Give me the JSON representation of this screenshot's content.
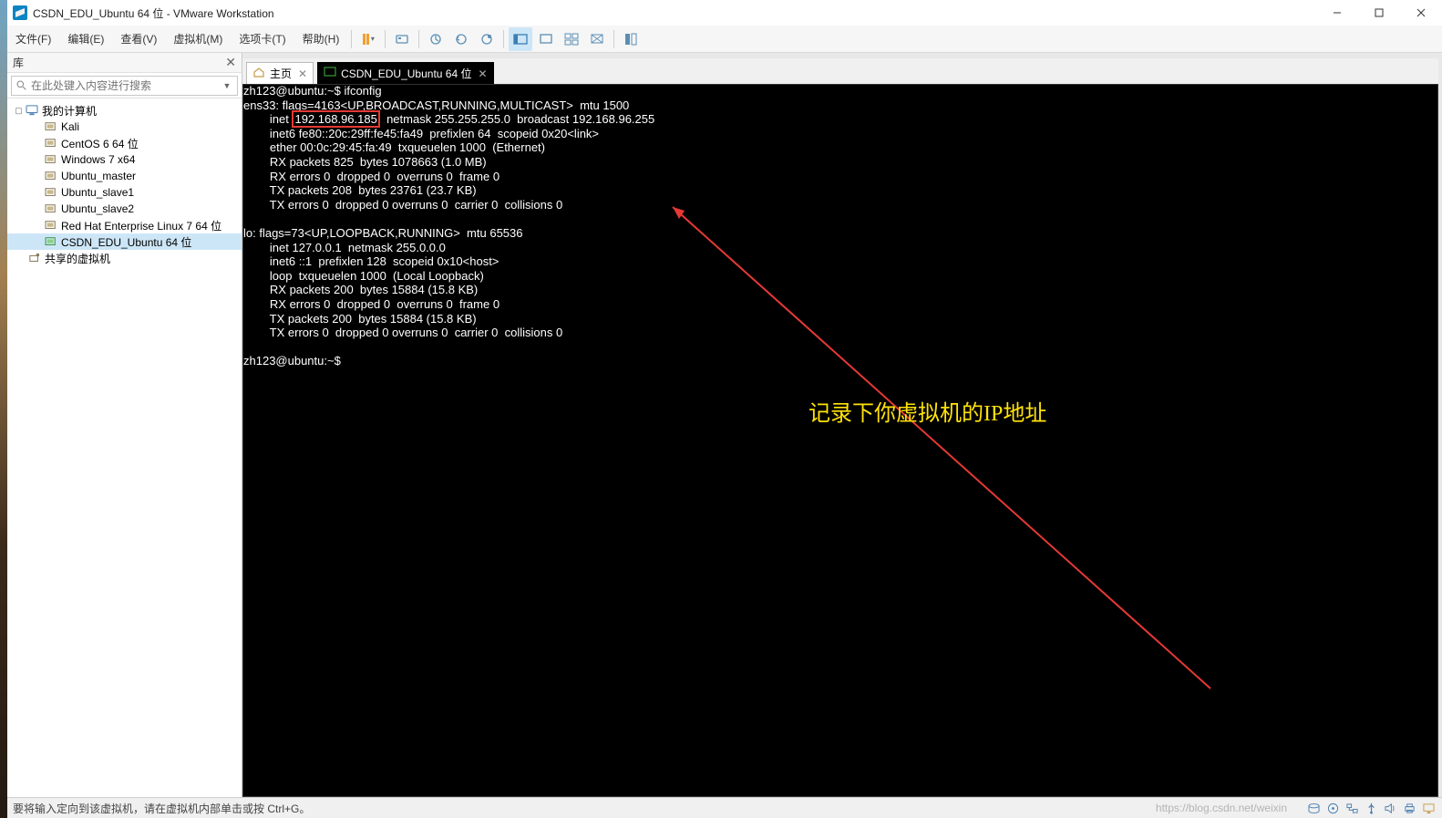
{
  "title": "CSDN_EDU_Ubuntu 64 位 - VMware Workstation",
  "menu": {
    "file": "文件(F)",
    "edit": "编辑(E)",
    "view": "查看(V)",
    "vm": "虚拟机(M)",
    "tabs": "选项卡(T)",
    "help": "帮助(H)"
  },
  "library": {
    "header": "库",
    "search_placeholder": "在此处键入内容进行搜索",
    "root": "我的计算机",
    "items": [
      "Kali",
      "CentOS 6 64 位",
      "Windows 7 x64",
      "Ubuntu_master",
      "Ubuntu_slave1",
      "Ubuntu_slave2",
      "Red Hat Enterprise Linux 7 64 位",
      "CSDN_EDU_Ubuntu 64 位"
    ],
    "shared": "共享的虚拟机"
  },
  "tabs": {
    "home": "主页",
    "vm": "CSDN_EDU_Ubuntu 64 位"
  },
  "terminal": {
    "prompt": "zh123@ubuntu:~$ ",
    "cmd": "ifconfig",
    "l1": "ens33: flags=4163<UP,BROADCAST,RUNNING,MULTICAST>  mtu 1500",
    "l2a": "        inet ",
    "ip": "192.168.96.185",
    "l2b": "  netmask 255.255.255.0  broadcast 192.168.96.255",
    "l3": "        inet6 fe80::20c:29ff:fe45:fa49  prefixlen 64  scopeid 0x20<link>",
    "l4": "        ether 00:0c:29:45:fa:49  txqueuelen 1000  (Ethernet)",
    "l5": "        RX packets 825  bytes 1078663 (1.0 MB)",
    "l6": "        RX errors 0  dropped 0  overruns 0  frame 0",
    "l7": "        TX packets 208  bytes 23761 (23.7 KB)",
    "l8": "        TX errors 0  dropped 0 overruns 0  carrier 0  collisions 0",
    "l9": "",
    "l10": "lo: flags=73<UP,LOOPBACK,RUNNING>  mtu 65536",
    "l11": "        inet 127.0.0.1  netmask 255.0.0.0",
    "l12": "        inet6 ::1  prefixlen 128  scopeid 0x10<host>",
    "l13": "        loop  txqueuelen 1000  (Local Loopback)",
    "l14": "        RX packets 200  bytes 15884 (15.8 KB)",
    "l15": "        RX errors 0  dropped 0  overruns 0  frame 0",
    "l16": "        TX packets 200  bytes 15884 (15.8 KB)",
    "l17": "        TX errors 0  dropped 0 overruns 0  carrier 0  collisions 0",
    "l18": "",
    "prompt2": "zh123@ubuntu:~$ "
  },
  "annotation": "记录下你虚拟机的IP地址",
  "statusbar": "要将输入定向到该虚拟机，请在虚拟机内部单击或按 Ctrl+G。",
  "watermark": "https://blog.csdn.net/weixin"
}
